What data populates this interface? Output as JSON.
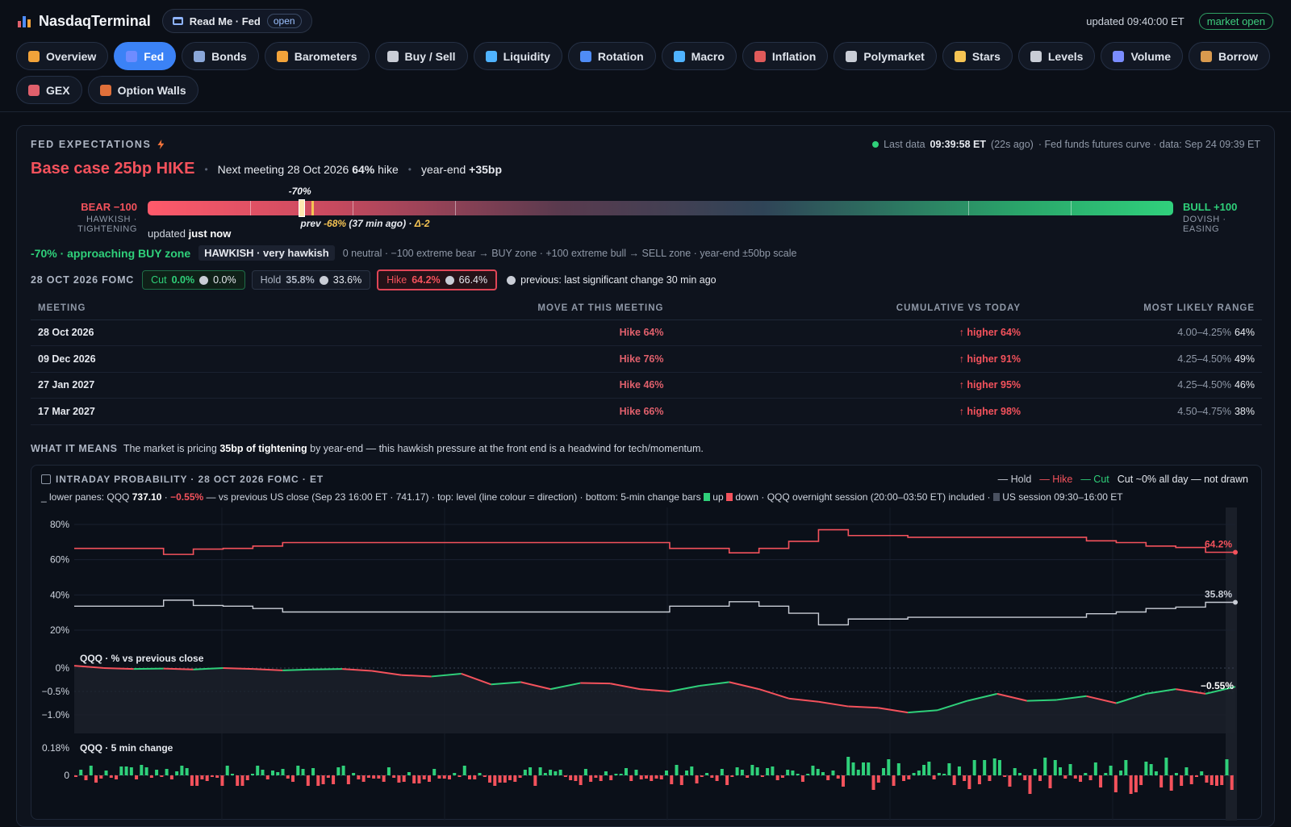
{
  "app": {
    "title": "NasdaqTerminal",
    "readme_label": "Read Me · Fed",
    "readme_state": "open",
    "updated": "updated 09:40:00 ET",
    "market_status": "market open"
  },
  "nav": [
    "Overview",
    "Fed",
    "Bonds",
    "Barometers",
    "Buy / Sell",
    "Liquidity",
    "Rotation",
    "Macro",
    "Inflation",
    "Polymarket",
    "Stars",
    "Levels",
    "Volume",
    "Borrow",
    "GEX",
    "Option Walls"
  ],
  "nav_active": "Fed",
  "nav_icon_colors": [
    "#f2a33a",
    "#6f8cff",
    "#8aa7d9",
    "#f2a33a",
    "#c9cdd6",
    "#4fb3ff",
    "#4f8cf6",
    "#4fb3ff",
    "#e05a5a",
    "#c9cdd6",
    "#f6c453",
    "#c9cdd6",
    "#7a8cff",
    "#d99a4e",
    "#e0606c",
    "#e0703a"
  ],
  "fed": {
    "title": "FED EXPECTATIONS",
    "last_data_label": "Last data",
    "last_data_time": "09:39:58 ET",
    "last_data_ago": "(22s ago)",
    "last_data_src": "· Fed funds futures curve · data: Sep 24 09:39 ET",
    "base_case": "Base case 25bp HIKE",
    "next_meeting_label": "Next meeting 28 Oct 2026",
    "next_meeting_prob": "64%",
    "next_meeting_move": "hike",
    "yearend_label": "year-end",
    "yearend_value": "+35bp"
  },
  "gauge": {
    "bear_label": "BEAR −100",
    "bear_sub": "HAWKISH · TIGHTENING",
    "bull_label": "BULL +100",
    "bull_sub": "DOVISH · EASING",
    "now_label": "-70%",
    "now_value": -70,
    "prev_label": "prev",
    "prev_value": "-68%",
    "prev_ago": "(37 min ago) ·",
    "prev_delta": "Δ-2",
    "prev_pos": -68,
    "ticks": [
      -80,
      -60,
      -40,
      60,
      80
    ],
    "updated_label": "updated",
    "updated_value": "just now"
  },
  "status": {
    "zone": "-70% · approaching BUY zone",
    "tone": "HAWKISH · very hawkish",
    "note": "0 neutral · −100 extreme bear → BUY zone · +100 extreme bull → SELL zone · year-end ±50bp scale"
  },
  "fomc": {
    "title": "28 OCT 2026 FOMC",
    "cut_label": "Cut",
    "cut_pct": "0.0%",
    "cut_prev": "0.0%",
    "hold_label": "Hold",
    "hold_pct": "35.8%",
    "hold_prev": "33.6%",
    "hike_label": "Hike",
    "hike_pct": "64.2%",
    "hike_prev": "66.4%",
    "previous_note": "previous: last significant change 30 min ago"
  },
  "table": {
    "headers": [
      "MEETING",
      "MOVE AT THIS MEETING",
      "CUMULATIVE VS TODAY",
      "MOST LIKELY RANGE"
    ],
    "rows": [
      {
        "meeting": "28 Oct 2026",
        "move": "Hike 64%",
        "cum": "↑ higher 64%",
        "range": "4.00–4.25%",
        "range_pct": "64%"
      },
      {
        "meeting": "09 Dec 2026",
        "move": "Hike 76%",
        "cum": "↑ higher 91%",
        "range": "4.25–4.50%",
        "range_pct": "49%"
      },
      {
        "meeting": "27 Jan 2027",
        "move": "Hike 46%",
        "cum": "↑ higher 95%",
        "range": "4.25–4.50%",
        "range_pct": "46%"
      },
      {
        "meeting": "17 Mar 2027",
        "move": "Hike 66%",
        "cum": "↑ higher 98%",
        "range": "4.50–4.75%",
        "range_pct": "38%"
      }
    ]
  },
  "means": {
    "label": "WHAT IT MEANS",
    "pre": "The market is pricing",
    "bold": "35bp of tightening",
    "post": "by year-end — this hawkish pressure at the front end is a headwind for tech/momentum."
  },
  "chart": {
    "title": "INTRADAY PROBABILITY · 28 OCT 2026 FOMC · ET",
    "legend_hold": "— Hold",
    "legend_hike": "— Hike",
    "legend_cut": "— Cut",
    "legend_note": "Cut ~0% all day — not drawn",
    "sub_pre": "_ lower panes: QQQ",
    "sub_price": "737.10",
    "sub_mid": "·",
    "sub_chg": "−0.55%",
    "sub_post": "— vs previous US close (Sep 23 16:00 ET · 741.17) · top: level (line colour = direction) · bottom: 5-min change bars",
    "sub_up": "up",
    "sub_down": "down",
    "sub_tail": "· QQQ overnight session (20:00–03:50 ET) included ·",
    "sub_us": "US session 09:30–16:00 ET",
    "qqq_title": "QQQ · % vs previous close",
    "bars_title": "QQQ · 5 min change",
    "hike_end_label": "64.2%",
    "hold_end_label": "35.8%",
    "qqq_end_label": "−0.55%"
  },
  "chart_data": {
    "type": "line",
    "ylabels_prob": [
      "80%",
      "60%",
      "40%",
      "20%"
    ],
    "ylabels_qqq": [
      "0%",
      "−0.5%",
      "−1.0%"
    ],
    "ylabels_bars": [
      "0.18%",
      "0"
    ],
    "series": [
      {
        "name": "Hike",
        "values": [
          66.4,
          66.4,
          66.4,
          63.0,
          66.0,
          66.4,
          67.7,
          69.7,
          69.7,
          69.7,
          69.7,
          69.7,
          69.7,
          69.7,
          69.7,
          69.7,
          69.7,
          69.7,
          69.7,
          69.7,
          66.4,
          66.4,
          63.9,
          66.4,
          70.4,
          77.0,
          73.7,
          73.7,
          72.7,
          72.7,
          72.7,
          72.7,
          72.7,
          72.7,
          70.7,
          69.7,
          67.7,
          66.9,
          64.2,
          64.2
        ]
      },
      {
        "name": "Hold",
        "values": [
          33.6,
          33.6,
          33.6,
          37.0,
          34.0,
          33.6,
          32.3,
          30.3,
          30.3,
          30.3,
          30.3,
          30.3,
          30.3,
          30.3,
          30.3,
          30.3,
          30.3,
          30.3,
          30.3,
          30.3,
          33.6,
          33.6,
          36.1,
          33.6,
          29.6,
          23.0,
          26.3,
          26.3,
          27.3,
          27.3,
          27.3,
          27.3,
          27.3,
          27.3,
          29.3,
          30.3,
          32.3,
          33.1,
          35.8,
          35.8
        ]
      },
      {
        "name": "QQQ %",
        "values": [
          0.05,
          0.0,
          -0.02,
          -0.01,
          -0.03,
          0.0,
          -0.02,
          -0.05,
          -0.03,
          -0.02,
          -0.06,
          -0.15,
          -0.18,
          -0.12,
          -0.35,
          -0.3,
          -0.45,
          -0.32,
          -0.33,
          -0.45,
          -0.5,
          -0.38,
          -0.3,
          -0.45,
          -0.65,
          -0.72,
          -0.82,
          -0.85,
          -0.95,
          -0.9,
          -0.7,
          -0.55,
          -0.7,
          -0.68,
          -0.6,
          -0.75,
          -0.55,
          -0.45,
          -0.55,
          -0.4
        ]
      }
    ]
  }
}
